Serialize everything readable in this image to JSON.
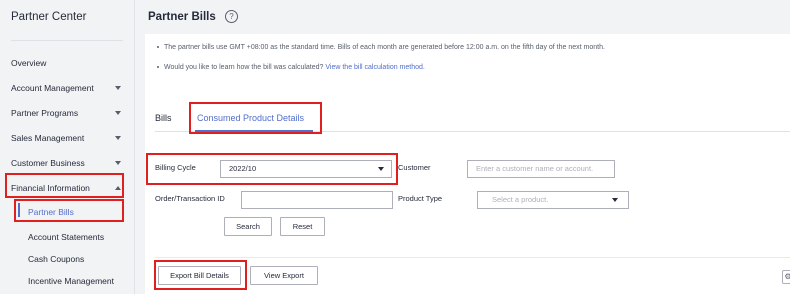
{
  "sidebar": {
    "title": "Partner Center",
    "items": [
      {
        "label": "Overview"
      },
      {
        "label": "Account Management"
      },
      {
        "label": "Partner Programs"
      },
      {
        "label": "Sales Management"
      },
      {
        "label": "Customer Business"
      },
      {
        "label": "Financial Information"
      }
    ],
    "subitems": [
      {
        "label": "Partner Bills"
      },
      {
        "label": "Account Statements"
      },
      {
        "label": "Cash Coupons"
      },
      {
        "label": "Incentive Management"
      }
    ]
  },
  "header": {
    "title": "Partner Bills",
    "help_glyph": "?"
  },
  "tips": {
    "line1": "The partner bills use GMT +08:00 as the standard time. Bills of each month are generated before 12:00 a.m. on the fifth day of the next month.",
    "line2_text": "Would you like to learn how the bill was calculated?",
    "line2_link": "View the bill calculation method."
  },
  "tabs": [
    {
      "label": "Bills"
    },
    {
      "label": "Consumed Product Details"
    }
  ],
  "filters": {
    "billing_cycle_label": "Billing Cycle",
    "billing_cycle_value": "2022/10",
    "customer_label": "Customer",
    "customer_placeholder": "Enter a customer name or account.",
    "order_label": "Order/Transaction ID",
    "order_value": "",
    "product_type_label": "Product Type",
    "product_type_placeholder": "Select a product."
  },
  "buttons": {
    "search": "Search",
    "reset": "Reset",
    "export_bill_details": "Export Bill Details",
    "view_export": "View Export"
  },
  "colors": {
    "accent": "#526ecc",
    "highlight": "#e0201f"
  }
}
